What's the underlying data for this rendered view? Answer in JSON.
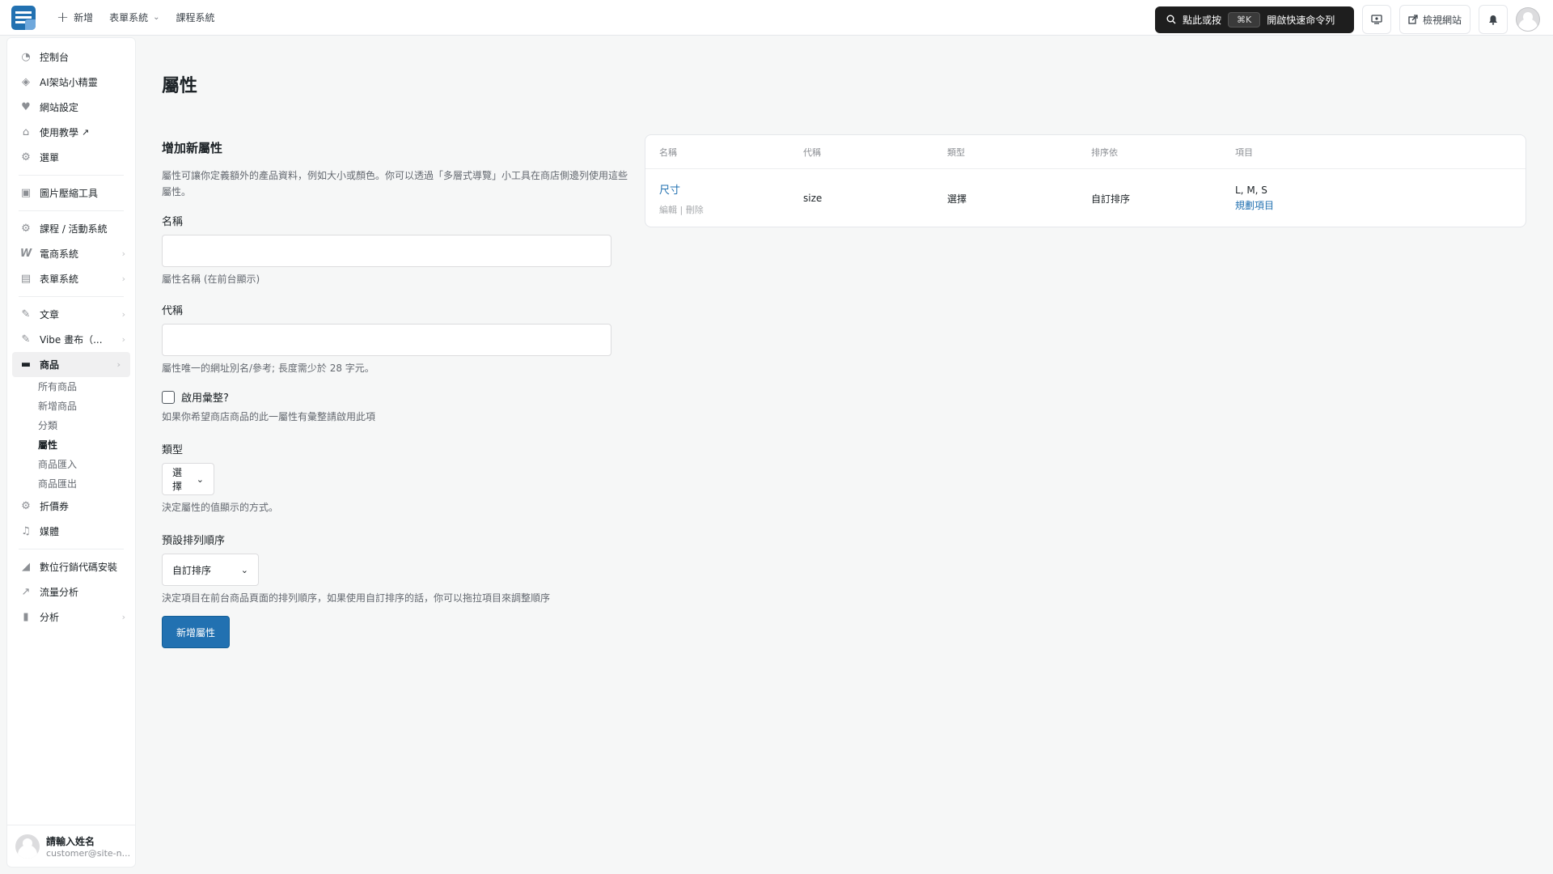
{
  "topbar": {
    "new_label": "新增",
    "forms_label": "表單系統",
    "courses_label": "課程系統",
    "command_prompt": "點此或按",
    "shortcut": "⌘K",
    "command_hint": "開啟快速命令列",
    "view_site": "檢視網站"
  },
  "sidebar": {
    "items": [
      {
        "label": "控制台",
        "icon": "dashboard-icon"
      },
      {
        "label": "AI架站小精靈",
        "icon": "diamond-icon"
      },
      {
        "label": "網站設定",
        "icon": "heart-icon"
      },
      {
        "label": "使用教學",
        "icon": "graduation-cap-icon",
        "ext": "↗"
      },
      {
        "label": "選單",
        "icon": "gear-icon"
      },
      {
        "label": "圖片壓縮工具",
        "icon": "image-compress-icon"
      },
      {
        "label": "課程 / 活動系統",
        "icon": "gear-icon"
      },
      {
        "label": "電商系統",
        "icon": "woo-icon"
      },
      {
        "label": "表單系統",
        "icon": "form-icon"
      },
      {
        "label": "文章",
        "icon": "pin-icon"
      },
      {
        "label": "Vibe 畫布（...",
        "icon": "pin-icon"
      },
      {
        "label": "商品",
        "icon": "archive-icon"
      },
      {
        "label": "折價券",
        "icon": "gear-icon"
      },
      {
        "label": "媒體",
        "icon": "media-icon"
      },
      {
        "label": "數位行銷代碼安裝",
        "icon": "chart-area-icon"
      },
      {
        "label": "流量分析",
        "icon": "chart-line-icon"
      },
      {
        "label": "分析",
        "icon": "bar-chart-icon"
      }
    ],
    "products_sub": [
      "所有商品",
      "新增商品",
      "分類",
      "屬性",
      "商品匯入",
      "商品匯出"
    ],
    "user": {
      "name": "請輸入姓名",
      "email": "customer@site-n..."
    }
  },
  "page": {
    "title": "屬性"
  },
  "form": {
    "heading": "增加新屬性",
    "description": "屬性可讓你定義額外的產品資料，例如大小或顏色。你可以透過「多層式導覽」小工具在商店側邊列使用這些屬性。",
    "name_label": "名稱",
    "name_value": "",
    "name_hint": "屬性名稱 (在前台顯示)",
    "slug_label": "代稱",
    "slug_value": "",
    "slug_hint": "屬性唯一的網址別名/參考; 長度需少於 28 字元。",
    "archives_label": "啟用彙整?",
    "archives_hint": "如果你希望商店商品的此一屬性有彙整請啟用此項",
    "type_label": "類型",
    "type_value": "選擇",
    "type_hint": "決定屬性的值顯示的方式。",
    "order_label": "預設排列順序",
    "order_value": "自訂排序",
    "order_hint": "決定項目在前台商品頁面的排列順序，如果使用自訂排序的話，你可以拖拉項目來調整順序",
    "submit_label": "新增屬性"
  },
  "table": {
    "headers": [
      "名稱",
      "代稱",
      "類型",
      "排序依",
      "項目"
    ],
    "rows": [
      {
        "name": "尺寸",
        "edit": "編輯",
        "sep": "|",
        "delete": "刪除",
        "slug": "size",
        "type": "選擇",
        "order": "自訂排序",
        "terms": "L, M, S",
        "configure": "規劃項目"
      }
    ]
  }
}
